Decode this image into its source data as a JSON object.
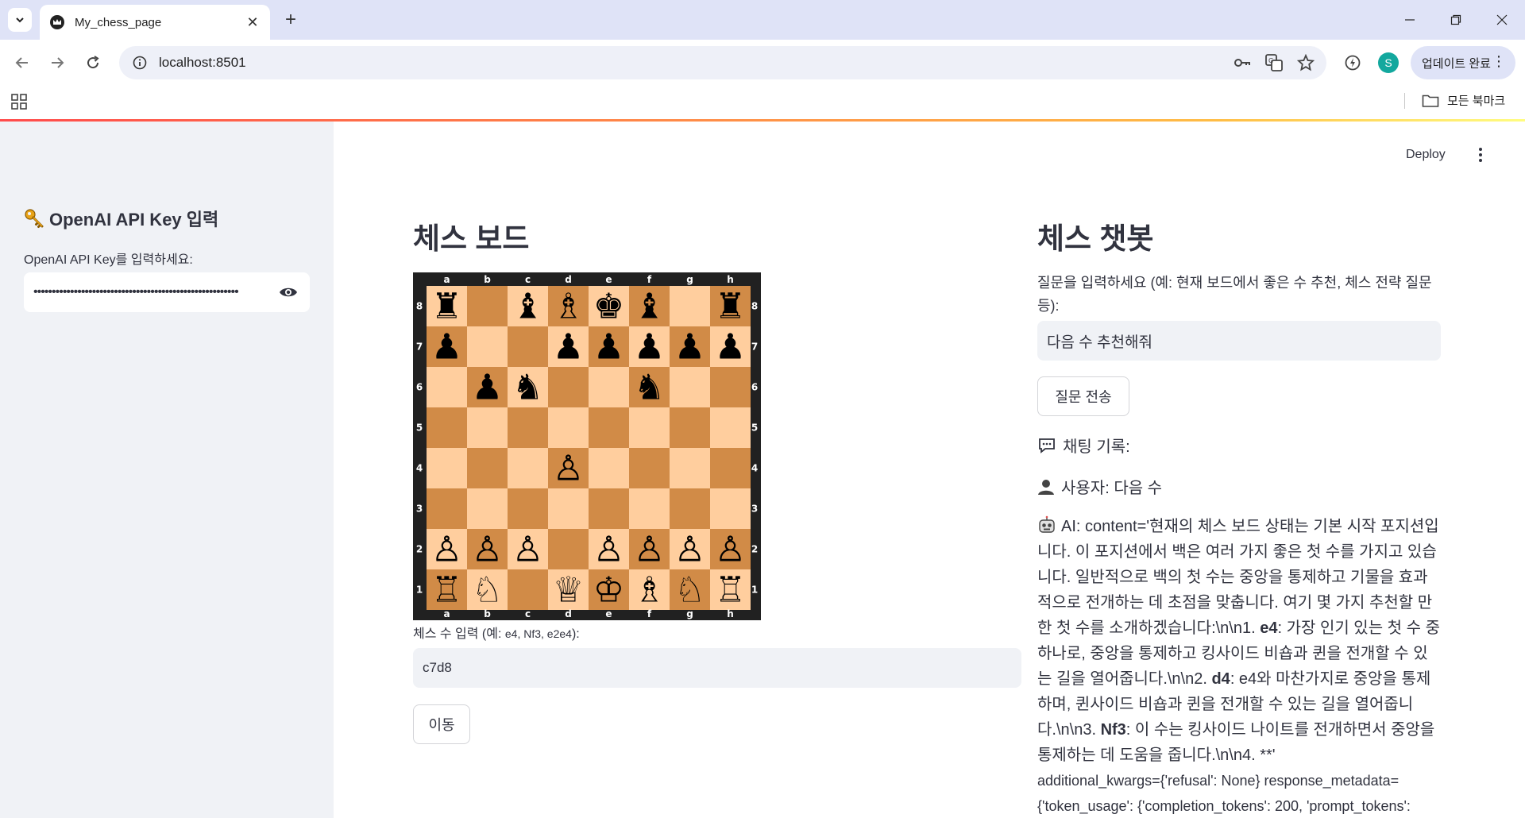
{
  "browser": {
    "tab_title": "My_chess_page",
    "url": "localhost:8501",
    "profile_initial": "S",
    "update_label": "업데이트 완료",
    "bookmarks_label": "모든 북마크"
  },
  "header": {
    "deploy_label": "Deploy"
  },
  "sidebar": {
    "title": "OpenAI API Key 입력",
    "key_label": "OpenAI API Key를 입력하세요:",
    "key_value_masked": "••••••••••••••••••••••••••••••••••••••••••••••••••••••••"
  },
  "board_section": {
    "title": "체스 보드",
    "files": [
      "a",
      "b",
      "c",
      "d",
      "e",
      "f",
      "g",
      "h"
    ],
    "ranks": [
      "8",
      "7",
      "6",
      "5",
      "4",
      "3",
      "2",
      "1"
    ],
    "position": [
      [
        "♜",
        "",
        "♝",
        "♗",
        "♚",
        "♝",
        "",
        "♜"
      ],
      [
        "♟",
        "",
        "",
        "♟",
        "♟",
        "♟",
        "♟",
        "♟"
      ],
      [
        "",
        "♟",
        "♞",
        "",
        "",
        "♞",
        "",
        ""
      ],
      [
        "",
        "",
        "",
        "",
        "",
        "",
        "",
        ""
      ],
      [
        "",
        "",
        "",
        "♙",
        "",
        "",
        "",
        ""
      ],
      [
        "",
        "",
        "",
        "",
        "",
        "",
        "",
        ""
      ],
      [
        "♙",
        "♙",
        "♙",
        "",
        "♙",
        "♙",
        "♙",
        "♙"
      ],
      [
        "♖",
        "♘",
        "",
        "♕",
        "♔",
        "♗",
        "♘",
        "♖"
      ]
    ],
    "colors": {
      "light": "#ffce9e",
      "dark": "#d18b47",
      "frame": "#212121"
    },
    "move_label_main": "체스 수 입력 (예: ",
    "move_label_small": "e4, Nf3, e2e4",
    "move_label_end": "):",
    "move_value": "c7d8",
    "move_button": "이동"
  },
  "chat_section": {
    "title": "체스 챗봇",
    "question_label": "질문을 입력하세요 (예: 현재 보드에서 좋은 수 추천, 체스 전략 질문 등):",
    "question_value": "다음 수 추천해줘",
    "send_button": "질문 전송",
    "history_label": "채팅 기록:",
    "user_message": "사용자: 다음 수",
    "ai_parts": {
      "p1": "AI: content='현재의 체스 보드 상태는 기본 시작 포지션입니다. 이 포지션에서 백은 여러 가지 좋은 첫 수를 가지고 있습니다. 일반적으로 백의 첫 수는 중앙을 통제하고 기물을 효과적으로 전개하는 데 초점을 맞춥니다. 여기 몇 가지 추천할 만한 첫 수를 소개하겠습니다:\\n\\n1. ",
      "b1": "e4",
      "p2": ": 가장 인기 있는 첫 수 중 하나로, 중앙을 통제하고 킹사이드 비숍과 퀸을 전개할 수 있는 길을 열어줍니다.\\n\\n2. ",
      "b2": "d4",
      "p3": ": e4와 마찬가지로 중앙을 통제하며, 퀸사이드 비숍과 퀸을 전개할 수 있는 길을 열어줍니다.\\n\\n3. ",
      "b3": "Nf3",
      "p4": ": 이 수는 킹사이드 나이트를 전개하면서 중앙을 통제하는 데 도움을 줍니다.\\n\\n4. **'",
      "meta": "additional_kwargs={'refusal': None} response_metadata={'token_usage': {'completion_tokens': 200, 'prompt_tokens':"
    }
  }
}
